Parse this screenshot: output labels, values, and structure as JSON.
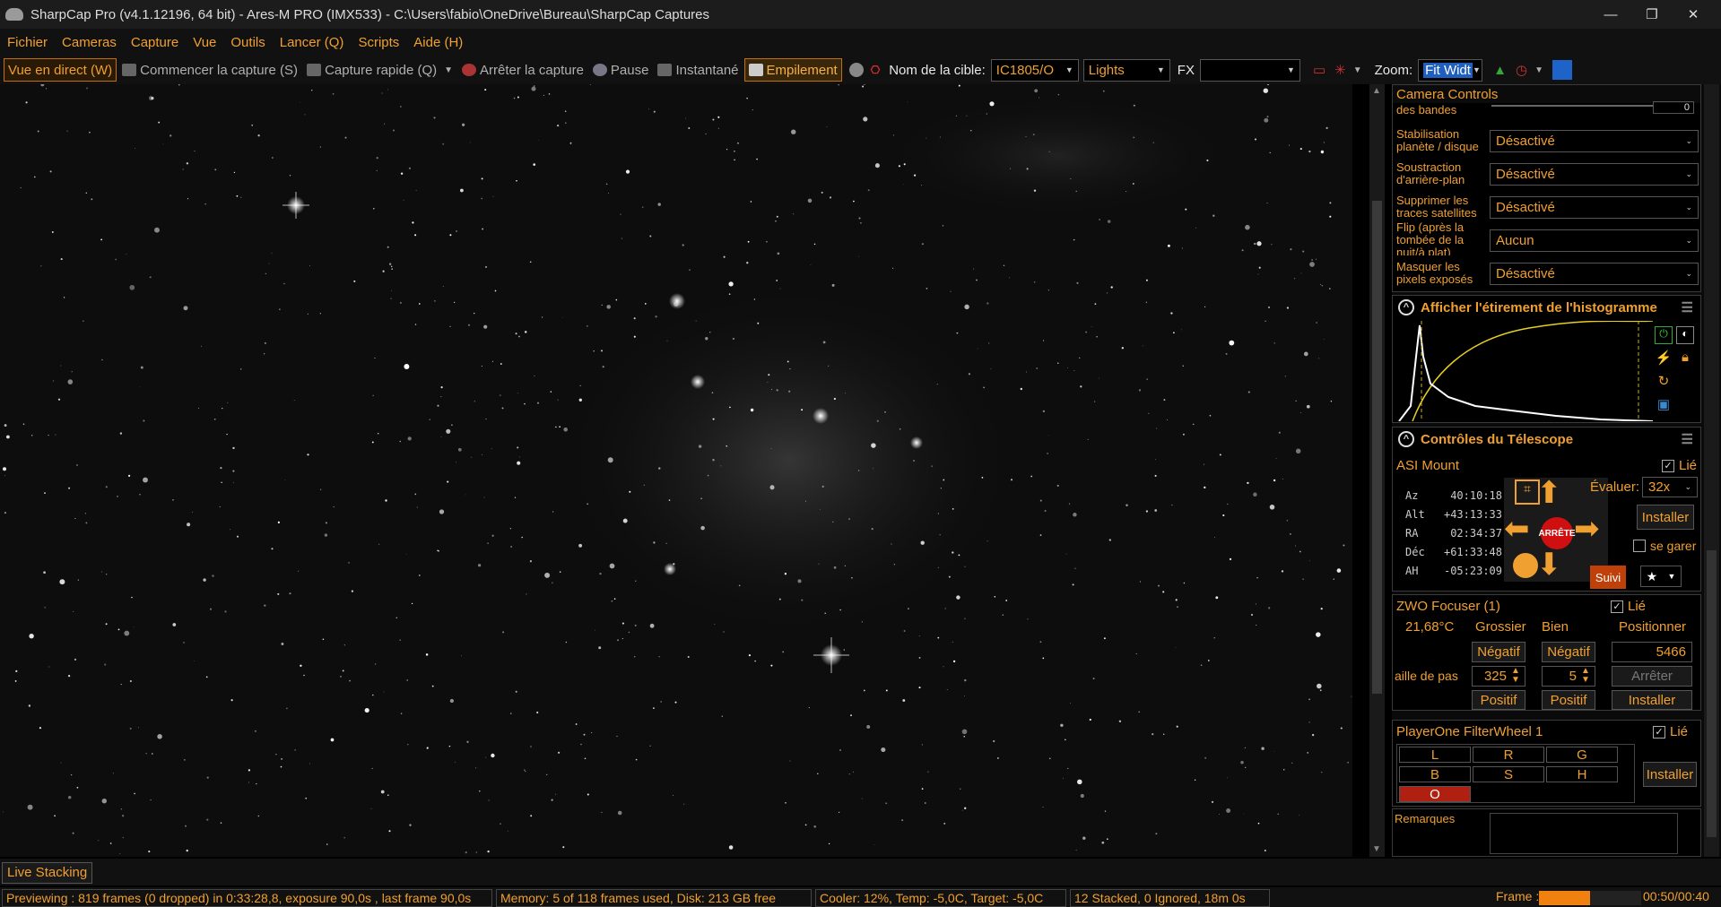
{
  "window": {
    "title": "SharpCap Pro (v4.1.12196, 64 bit) - Ares-M PRO (IMX533) - C:\\Users\\fabio\\OneDrive\\Bureau\\SharpCap Captures",
    "minimize": "—",
    "maximize": "❐",
    "close": "✕"
  },
  "menu": [
    "Fichier",
    "Cameras",
    "Capture",
    "Vue",
    "Outils",
    "Lancer (Q)",
    "Scripts",
    "Aide (H)"
  ],
  "toolbar": {
    "live": "Vue en direct (W)",
    "start": "Commencer la capture (S)",
    "quick": "Capture rapide (Q)",
    "stop": "Arrêter la capture",
    "pause": "Pause",
    "snapshot": "Instantané",
    "stack": "Empilement",
    "target_label": "Nom de la cible:",
    "target_value": "IC1805/O",
    "frame_type": "Lights",
    "fx": "FX",
    "fx_value": "",
    "zoom_label": "Zoom:",
    "zoom_value": "Fit Widt"
  },
  "camera_controls": {
    "title": "Camera Controls",
    "partial_label": "des bandes",
    "partial_value": "0",
    "rows": [
      {
        "label": "Stabilisation planète / disque",
        "value": "Désactivé"
      },
      {
        "label": "Soustraction d'arrière-plan",
        "value": "Désactivé"
      },
      {
        "label": "Supprimer les traces satellites",
        "value": "Désactivé"
      },
      {
        "label": "Flip (après la tombée de la nuit/à plat)",
        "value": "Aucun"
      },
      {
        "label": "Masquer les pixels exposés",
        "value": "Désactivé"
      }
    ]
  },
  "histogram": {
    "title": "Afficher l'étirement de l'histogramme"
  },
  "telescope": {
    "title": "Contrôles du Télescope",
    "mount": "ASI Mount",
    "linked": "Lié",
    "coords": [
      {
        "k": "Az",
        "v": "40:10:18"
      },
      {
        "k": "Alt",
        "v": "+43:13:33"
      },
      {
        "k": "RA",
        "v": "02:34:37"
      },
      {
        "k": "Déc",
        "v": "+61:33:48"
      },
      {
        "k": "AH",
        "v": "-05:23:09"
      }
    ],
    "rate_label": "Évaluer:",
    "rate_value": "32x",
    "setup": "Installer",
    "stop": "ARRÊTE",
    "park": "se garer",
    "track": "Suivi"
  },
  "focuser": {
    "title": "ZWO Focuser (1)",
    "linked": "Lié",
    "temp": "21,68°C",
    "coarse": "Grossier",
    "fine": "Bien",
    "position_label": "Positionner",
    "neg": "Négatif",
    "pos": "Positif",
    "step_label": "aille de pas",
    "coarse_step": "325",
    "fine_step": "5",
    "position": "5466",
    "stop": "Arrêter",
    "setup": "Installer"
  },
  "filterwheel": {
    "title": "PlayerOne FilterWheel 1",
    "linked": "Lié",
    "filters": [
      "L",
      "R",
      "G",
      "B",
      "S",
      "H",
      "O"
    ],
    "active": "O",
    "setup": "Installer"
  },
  "notes": {
    "label": "Remarques"
  },
  "tab": "Live Stacking",
  "status": {
    "preview": "Previewing : 819 frames (0 dropped) in 0:33:28,8, exposure 90,0s , last frame 90,0s",
    "memory": "Memory: 5 of 118 frames used, Disk: 213 GB free",
    "cooler": "Cooler: 12%, Temp: -5,0C, Target: -5,0C",
    "stacked": "12 Stacked, 0 Ignored, 18m 0s",
    "frame_label": "Frame :",
    "frame_progress": 0.5,
    "frame_time": "00:50/00:40"
  },
  "colors": {
    "accent": "#f0a030",
    "stop_red": "#d01010"
  }
}
